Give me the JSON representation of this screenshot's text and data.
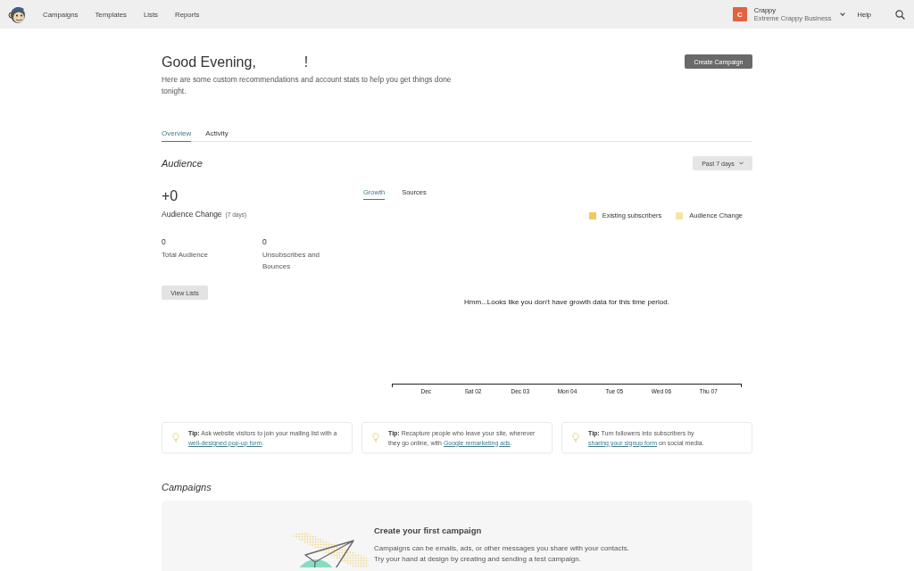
{
  "nav": {
    "items": [
      "Campaigns",
      "Templates",
      "Lists",
      "Reports"
    ],
    "help": "Help"
  },
  "account": {
    "initial": "C",
    "name": "Crappy",
    "business": "Extreme Crappy Business"
  },
  "header": {
    "greeting": "Good Evening,",
    "greeting_end": "!",
    "subtitle": "Here are some custom recommendations and account stats to help you get things done tonight.",
    "create_button": "Create Campaign"
  },
  "tabs": [
    {
      "label": "Overview",
      "selected": true
    },
    {
      "label": "Activity",
      "selected": false
    }
  ],
  "audience": {
    "title": "Audience",
    "period_button": "Past 7 days",
    "change_value": "+0",
    "change_label": "Audience Change",
    "change_period": "(7 days)",
    "stats": [
      {
        "value": "0",
        "label": "Total Audience"
      },
      {
        "value": "0",
        "label": "Unsubscribes and Bounces"
      }
    ],
    "view_button": "View Lists",
    "chart_tabs": [
      {
        "label": "Growth",
        "selected": true
      },
      {
        "label": "Sources",
        "selected": false
      }
    ],
    "legend": [
      {
        "label": "Existing subscribers",
        "color": "#f0c95c"
      },
      {
        "label": "Audience Change",
        "color": "#f6e3a6"
      }
    ],
    "empty_message": "Hmm...Looks like you don’t have growth data for this time period.",
    "x_labels": [
      "Dec",
      "Sat 02",
      "Dec 03",
      "Mon 04",
      "Tue 05",
      "Wed 06",
      "Thu 07"
    ]
  },
  "tips": [
    {
      "text": "**Tip:** Ask website visitors to join your mailing list with a",
      "link": "well-designed pop-up form",
      "after": "."
    },
    {
      "text": "**Tip:** Recapture people who leave your site, wherever they go online, with",
      "link": "Google remarketing ads",
      "after": "."
    },
    {
      "text": "**Tip:** Turn followers into subscribers by",
      "link": "sharing your signup form",
      "after": " on social media."
    }
  ],
  "campaigns": {
    "title": "Campaigns",
    "card_title": "Create your first campaign",
    "lines": [
      "Campaigns can be emails, ads, or other messages you share with your contacts.",
      "Try your hand at design by creating and sending a test campaign."
    ]
  }
}
